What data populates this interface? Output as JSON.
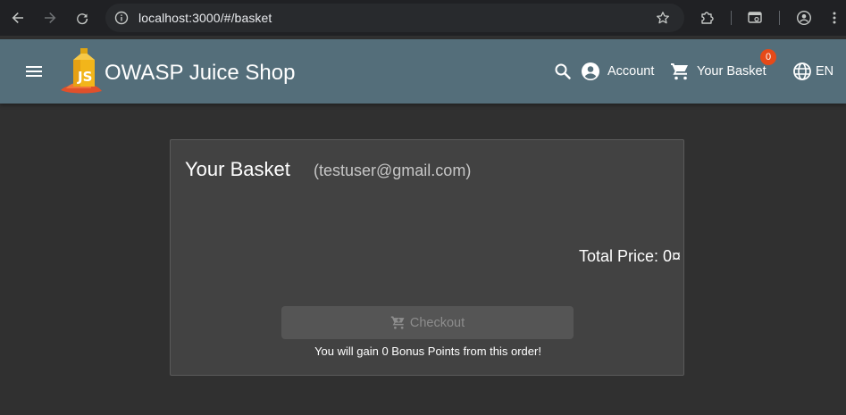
{
  "browser": {
    "url": "localhost:3000/#/basket"
  },
  "app": {
    "title": "OWASP Juice Shop",
    "account_label": "Account",
    "basket_label": "Your Basket",
    "basket_count": "0",
    "language_label": "EN"
  },
  "basket": {
    "title": "Your Basket",
    "user": "(testuser@gmail.com)",
    "total_price": "Total Price: 0¤",
    "checkout_label": "Checkout",
    "bonus_text": "You will gain 0 Bonus Points from this order!"
  },
  "colors": {
    "toolbar": "#546e7a",
    "background": "#303030",
    "card": "#424242",
    "badge": "#e64a19"
  }
}
